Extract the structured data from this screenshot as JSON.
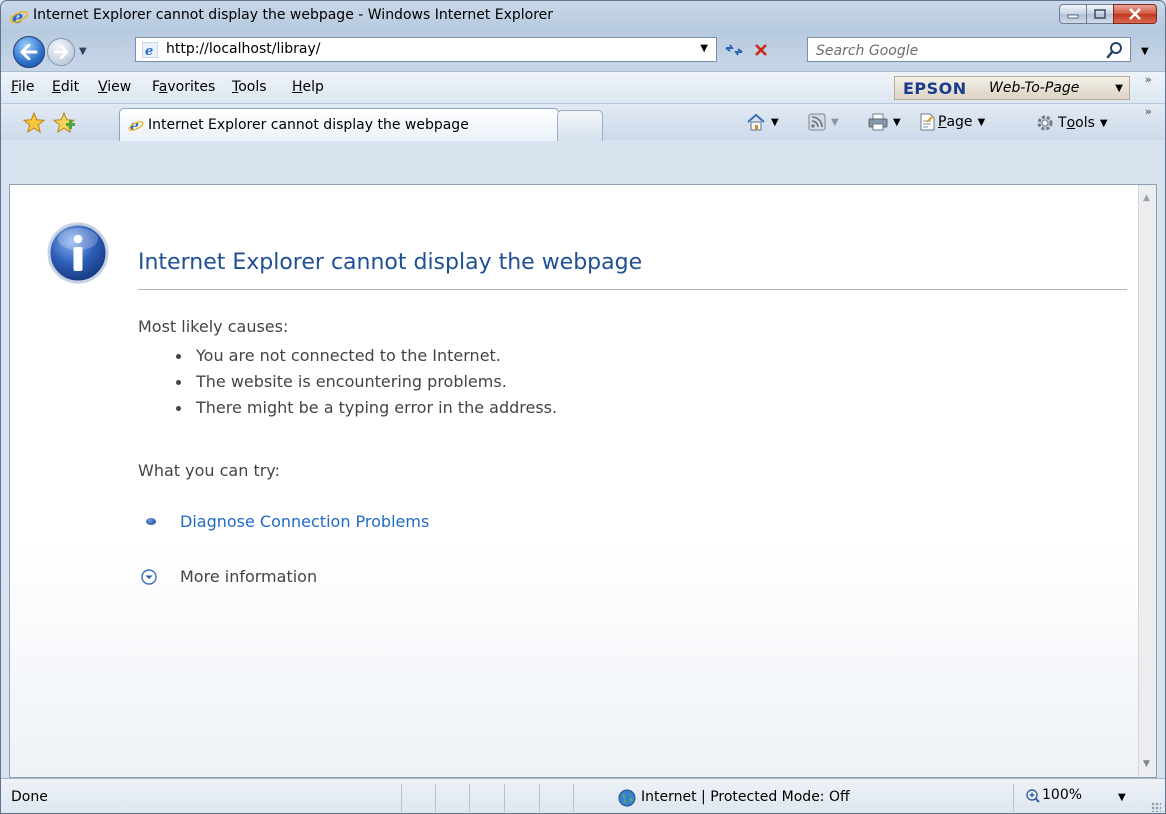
{
  "window": {
    "title": "Internet Explorer cannot display the webpage - Windows Internet Explorer"
  },
  "address_bar": {
    "url": "http://localhost/libray/"
  },
  "search": {
    "placeholder": "Search Google"
  },
  "menu": {
    "items": [
      {
        "key": "F",
        "rest": "ile"
      },
      {
        "key": "E",
        "rest": "dit"
      },
      {
        "key": "V",
        "rest": "iew"
      },
      {
        "key": "a",
        "prefix": "F",
        "rest": "vorites"
      },
      {
        "key": "T",
        "rest": "ools"
      },
      {
        "key": "H",
        "rest": "elp"
      }
    ]
  },
  "epson_toolbar": {
    "brand": "EPSON",
    "label": "Web-To-Page"
  },
  "tab": {
    "label": "Internet Explorer cannot display the webpage"
  },
  "command_bar": {
    "page_key": "P",
    "page_rest": "age",
    "tools_prefix": "T",
    "tools_key": "o",
    "tools_rest": "ols"
  },
  "content": {
    "heading": "Internet Explorer cannot display the webpage",
    "causes_label": "Most likely causes:",
    "causes": [
      "You are not connected to the Internet.",
      "The website is encountering problems.",
      "There might be a typing error in the address."
    ],
    "try_label": "What you can try:",
    "diagnose_link": "Diagnose Connection Problems",
    "more_info": "More information"
  },
  "status_bar": {
    "status": "Done",
    "zone": "Internet | Protected Mode: Off",
    "zoom": "100%"
  }
}
